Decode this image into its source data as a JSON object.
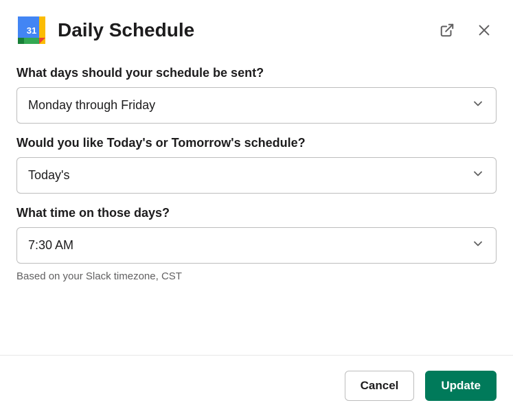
{
  "header": {
    "title": "Daily Schedule",
    "app_icon": {
      "day_number": "31"
    }
  },
  "fields": {
    "days": {
      "label": "What days should your schedule be sent?",
      "value": "Monday through Friday"
    },
    "which_schedule": {
      "label": "Would you like Today's or Tomorrow's schedule?",
      "value": "Today's"
    },
    "time": {
      "label": "What time on those days?",
      "value": "7:30 AM",
      "helper": "Based on your Slack timezone, CST"
    }
  },
  "footer": {
    "cancel_label": "Cancel",
    "submit_label": "Update"
  }
}
